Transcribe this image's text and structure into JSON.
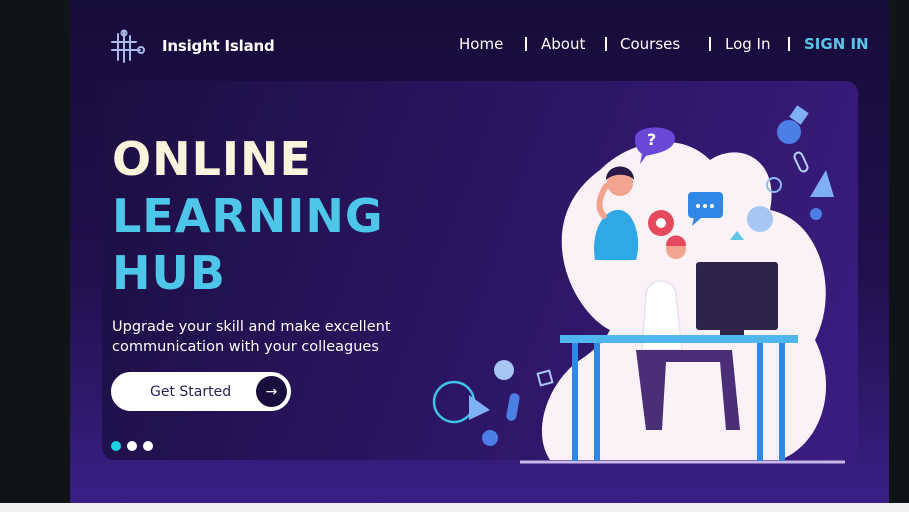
{
  "brand": {
    "name": "Insight Island",
    "logo_icon": "circuit-logo-icon"
  },
  "nav": {
    "items": [
      "Home",
      "About",
      "Courses",
      "Log In"
    ],
    "signin": "SIGN IN"
  },
  "hero": {
    "headline": [
      "ONLINE",
      "LEARNING",
      "HUB"
    ],
    "subtext_lines": [
      "Upgrade your skill and make excellent",
      "communication with your colleagues"
    ],
    "cta_label": "Get Started",
    "cta_icon": "arrow-right-icon",
    "slides_total": 3,
    "slide_active": 1
  },
  "colors": {
    "accent": "#4ec6ea",
    "signin": "#5ac3e8",
    "headline_first": "#fbf4dc",
    "dot_active": "#1ad1e2",
    "background": "#22104d"
  }
}
